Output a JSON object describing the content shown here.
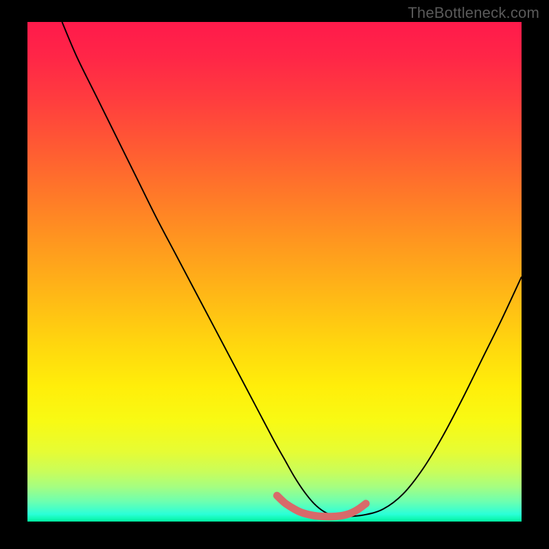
{
  "watermark": "TheBottleneck.com",
  "chart_data": {
    "type": "line",
    "title": "",
    "xlabel": "",
    "ylabel": "",
    "xlim": [
      0,
      100
    ],
    "ylim": [
      0,
      100
    ],
    "grid": false,
    "legend": false,
    "gradient_stops": [
      {
        "offset": 0.0,
        "color": "#ff1a4b"
      },
      {
        "offset": 0.07,
        "color": "#ff2647"
      },
      {
        "offset": 0.15,
        "color": "#ff3b3f"
      },
      {
        "offset": 0.25,
        "color": "#ff5a33"
      },
      {
        "offset": 0.35,
        "color": "#ff7a28"
      },
      {
        "offset": 0.45,
        "color": "#ff9a1e"
      },
      {
        "offset": 0.55,
        "color": "#ffb916"
      },
      {
        "offset": 0.65,
        "color": "#ffd80e"
      },
      {
        "offset": 0.73,
        "color": "#ffee0a"
      },
      {
        "offset": 0.8,
        "color": "#f8fa14"
      },
      {
        "offset": 0.86,
        "color": "#e6fc34"
      },
      {
        "offset": 0.9,
        "color": "#c9fd5a"
      },
      {
        "offset": 0.93,
        "color": "#a6fe80"
      },
      {
        "offset": 0.96,
        "color": "#6dffb0"
      },
      {
        "offset": 0.985,
        "color": "#2bffd8"
      },
      {
        "offset": 1.0,
        "color": "#00f5a0"
      }
    ],
    "series": [
      {
        "name": "bottleneck-curve",
        "color": "#000000",
        "width": 2.0,
        "x": [
          7,
          10,
          14,
          18,
          22,
          26,
          30,
          34,
          38,
          42,
          46,
          50,
          52,
          54,
          56,
          58,
          60,
          62,
          64,
          68,
          72,
          76,
          80,
          84,
          88,
          92,
          96,
          100
        ],
        "y": [
          100,
          93,
          85,
          77,
          69,
          61,
          53.5,
          46,
          38.5,
          31,
          23.5,
          16,
          12.5,
          9,
          6,
          3.6,
          2.0,
          1.2,
          1.0,
          1.3,
          2.5,
          5.5,
          10.5,
          17,
          24.5,
          32.5,
          40.5,
          49
        ]
      },
      {
        "name": "optimal-band",
        "color": "#d86a6a",
        "width": 11,
        "linecap": "round",
        "x": [
          50.5,
          52,
          53.5,
          55,
          56.5,
          58,
          59.5,
          61,
          62.5,
          64,
          65.5,
          67,
          68.5
        ],
        "y": [
          5.2,
          3.8,
          2.8,
          2.0,
          1.5,
          1.2,
          1.05,
          1.0,
          1.05,
          1.25,
          1.7,
          2.5,
          3.6
        ]
      }
    ]
  }
}
